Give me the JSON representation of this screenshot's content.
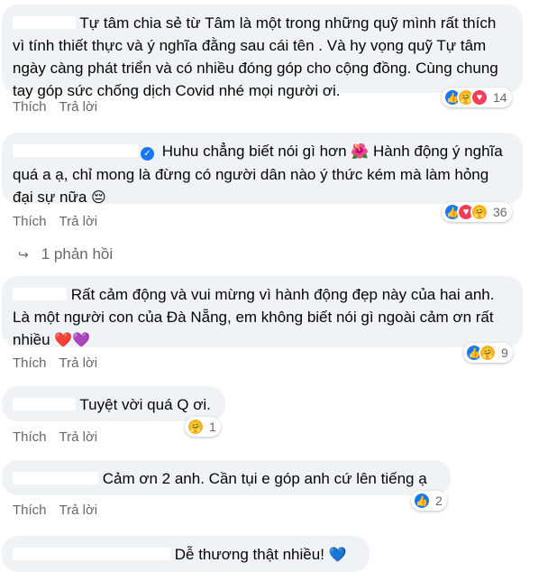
{
  "labels": {
    "like": "Thích",
    "reply": "Trả lời"
  },
  "comments": [
    {
      "text": "Tự tâm chia sẻ từ Tâm là một trong những quỹ mình rất thích vì tính thiết thực và ý nghĩa đằng sau cái tên . Và hy vọng quỹ Tự tâm ngày càng phát triển và có nhiều đóng góp cho cộng đồng. Cùng chung tay góp sức chống dịch Covid nhé mọi người ơi.",
      "reaction_count": "14"
    },
    {
      "text": "Huhu chẳng biết nói gì hơn",
      "emoji1": "🌺",
      "text2": "Hành động ý nghĩa quá a ạ, chỉ mong là đừng có người dân nào ý thức kém mà làm hỏng đại sự nữa",
      "emoji2": "😔",
      "reaction_count": "36"
    },
    {
      "text": "Rất cảm động và vui mừng vì hành động đẹp này của hai anh. Là một người con của Đà Nẵng, em không biết nói gì ngoài cảm ơn rất nhiều",
      "emoji": "❤️💜",
      "reaction_count": "9"
    },
    {
      "text": "Tuyệt vời quá Q ơi.",
      "reaction_count": "1"
    },
    {
      "text": "Cảm ơn 2 anh. Cần tụi e góp anh cứ lên tiếng ạ",
      "reaction_count": "2"
    },
    {
      "text": "Dễ thương thật nhiều!",
      "emoji": "💙"
    }
  ],
  "replies_link": "1 phản hồi",
  "icons": {
    "like": "like-icon",
    "love": "love-icon",
    "care": "care-icon",
    "reply_arrow": "reply-arrow-icon",
    "verified": "verified-badge-icon"
  },
  "colors": {
    "bubble": "#f0f2f5",
    "action": "#65676b",
    "like": "#1877f2",
    "love": "#f33e58",
    "care": "#f7b125"
  }
}
